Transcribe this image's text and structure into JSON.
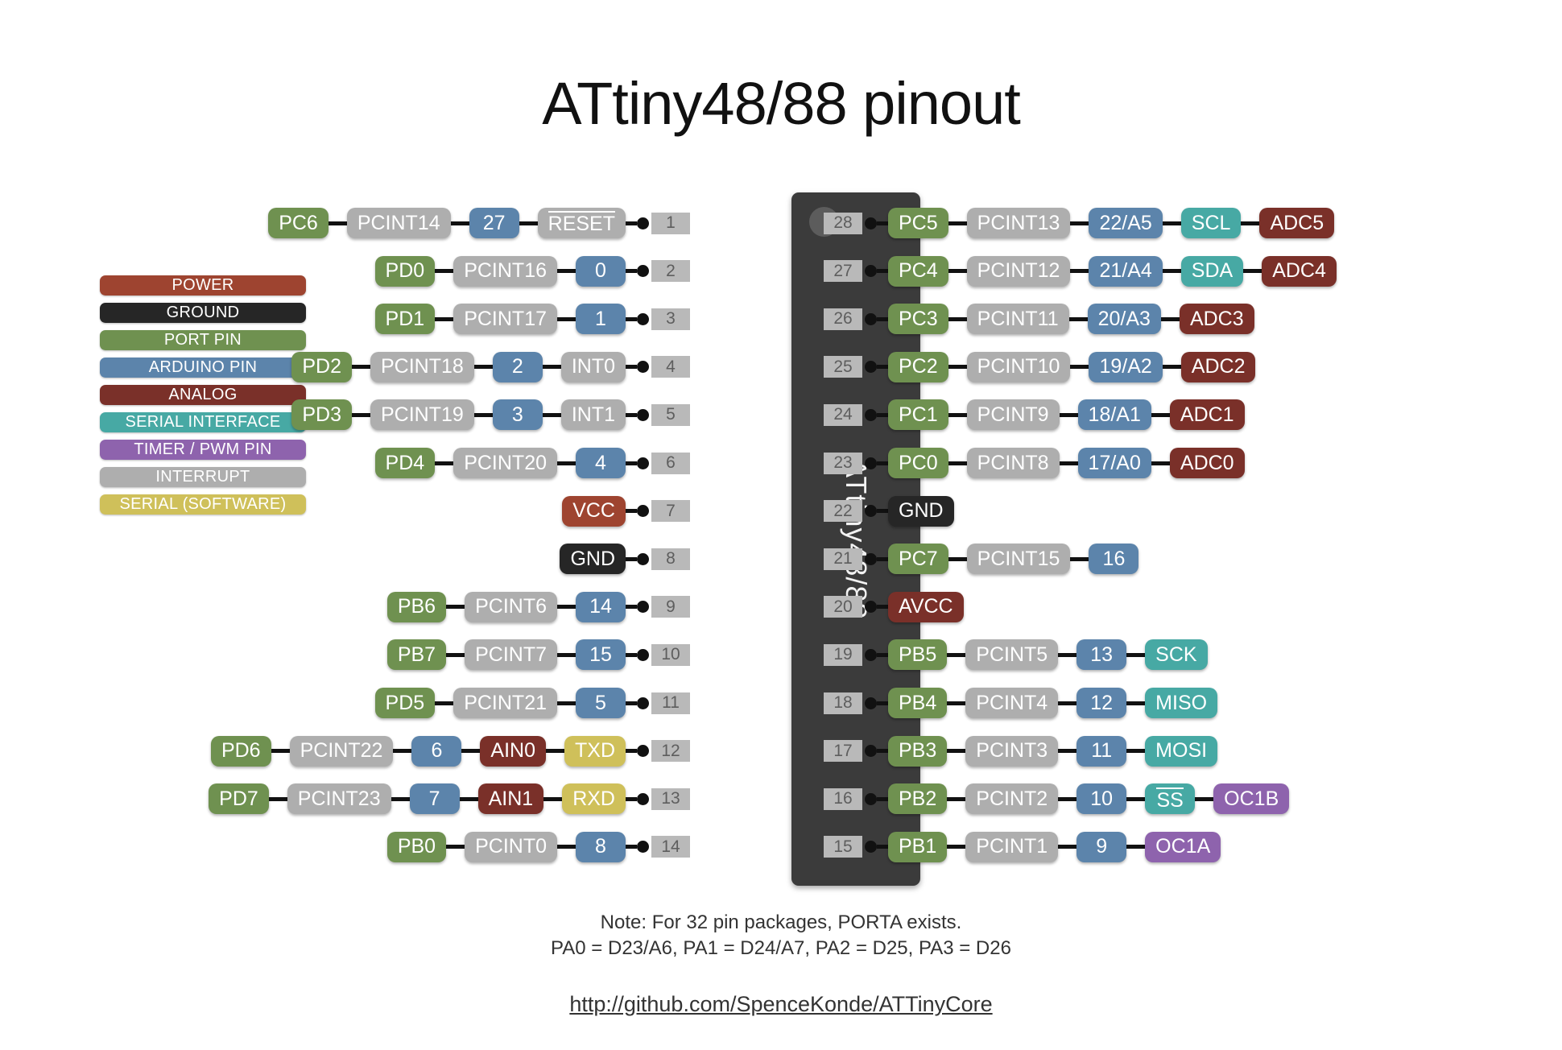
{
  "title": "ATtiny48/88 pinout",
  "chip": {
    "label": "ATtiny48/88"
  },
  "colors": {
    "power": "#9e4430",
    "ground": "#262626",
    "port": "#6f9150",
    "arduino": "#5c84ab",
    "analog": "#7a3029",
    "serial": "#47a9a4",
    "timer": "#8e63ad",
    "interrupt": "#aeaeae",
    "software": "#cfc05a",
    "pin_tab": "#b9b9b9",
    "wire": "#111111"
  },
  "legend": [
    {
      "label": "POWER",
      "type": "power"
    },
    {
      "label": "GROUND",
      "type": "ground"
    },
    {
      "label": "PORT PIN",
      "type": "port"
    },
    {
      "label": "ARDUINO PIN",
      "type": "arduino"
    },
    {
      "label": "ANALOG",
      "type": "analog"
    },
    {
      "label": "SERIAL INTERFACE",
      "type": "serial"
    },
    {
      "label": "TIMER / PWM PIN",
      "type": "timer"
    },
    {
      "label": "INTERRUPT",
      "type": "interrupt"
    },
    {
      "label": "SERIAL (SOFTWARE)",
      "type": "software"
    }
  ],
  "left_pins": [
    {
      "pin": "1",
      "badges": [
        {
          "label": "RESET",
          "type": "interrupt",
          "overline": true
        },
        {
          "label": "27",
          "type": "arduino"
        },
        {
          "label": "PCINT14",
          "type": "interrupt"
        },
        {
          "label": "PC6",
          "type": "port"
        }
      ]
    },
    {
      "pin": "2",
      "badges": [
        {
          "label": "0",
          "type": "arduino"
        },
        {
          "label": "PCINT16",
          "type": "interrupt"
        },
        {
          "label": "PD0",
          "type": "port"
        }
      ]
    },
    {
      "pin": "3",
      "badges": [
        {
          "label": "1",
          "type": "arduino"
        },
        {
          "label": "PCINT17",
          "type": "interrupt"
        },
        {
          "label": "PD1",
          "type": "port"
        }
      ]
    },
    {
      "pin": "4",
      "badges": [
        {
          "label": "INT0",
          "type": "interrupt"
        },
        {
          "label": "2",
          "type": "arduino"
        },
        {
          "label": "PCINT18",
          "type": "interrupt"
        },
        {
          "label": "PD2",
          "type": "port"
        }
      ]
    },
    {
      "pin": "5",
      "badges": [
        {
          "label": "INT1",
          "type": "interrupt"
        },
        {
          "label": "3",
          "type": "arduino"
        },
        {
          "label": "PCINT19",
          "type": "interrupt"
        },
        {
          "label": "PD3",
          "type": "port"
        }
      ]
    },
    {
      "pin": "6",
      "badges": [
        {
          "label": "4",
          "type": "arduino"
        },
        {
          "label": "PCINT20",
          "type": "interrupt"
        },
        {
          "label": "PD4",
          "type": "port"
        }
      ]
    },
    {
      "pin": "7",
      "badges": [
        {
          "label": "VCC",
          "type": "power"
        }
      ]
    },
    {
      "pin": "8",
      "badges": [
        {
          "label": "GND",
          "type": "ground"
        }
      ]
    },
    {
      "pin": "9",
      "badges": [
        {
          "label": "14",
          "type": "arduino"
        },
        {
          "label": "PCINT6",
          "type": "interrupt"
        },
        {
          "label": "PB6",
          "type": "port"
        }
      ]
    },
    {
      "pin": "10",
      "badges": [
        {
          "label": "15",
          "type": "arduino"
        },
        {
          "label": "PCINT7",
          "type": "interrupt"
        },
        {
          "label": "PB7",
          "type": "port"
        }
      ]
    },
    {
      "pin": "11",
      "badges": [
        {
          "label": "5",
          "type": "arduino"
        },
        {
          "label": "PCINT21",
          "type": "interrupt"
        },
        {
          "label": "PD5",
          "type": "port"
        }
      ]
    },
    {
      "pin": "12",
      "badges": [
        {
          "label": "TXD",
          "type": "software"
        },
        {
          "label": "AIN0",
          "type": "analog"
        },
        {
          "label": "6",
          "type": "arduino"
        },
        {
          "label": "PCINT22",
          "type": "interrupt"
        },
        {
          "label": "PD6",
          "type": "port"
        }
      ]
    },
    {
      "pin": "13",
      "badges": [
        {
          "label": "RXD",
          "type": "software"
        },
        {
          "label": "AIN1",
          "type": "analog"
        },
        {
          "label": "7",
          "type": "arduino"
        },
        {
          "label": "PCINT23",
          "type": "interrupt"
        },
        {
          "label": "PD7",
          "type": "port"
        }
      ]
    },
    {
      "pin": "14",
      "badges": [
        {
          "label": "8",
          "type": "arduino"
        },
        {
          "label": "PCINT0",
          "type": "interrupt"
        },
        {
          "label": "PB0",
          "type": "port"
        }
      ]
    }
  ],
  "right_pins": [
    {
      "pin": "28",
      "badges": [
        {
          "label": "PC5",
          "type": "port"
        },
        {
          "label": "PCINT13",
          "type": "interrupt"
        },
        {
          "label": "22/A5",
          "type": "arduino"
        },
        {
          "label": "SCL",
          "type": "serial"
        },
        {
          "label": "ADC5",
          "type": "analog"
        }
      ]
    },
    {
      "pin": "27",
      "badges": [
        {
          "label": "PC4",
          "type": "port"
        },
        {
          "label": "PCINT12",
          "type": "interrupt"
        },
        {
          "label": "21/A4",
          "type": "arduino"
        },
        {
          "label": "SDA",
          "type": "serial"
        },
        {
          "label": "ADC4",
          "type": "analog"
        }
      ]
    },
    {
      "pin": "26",
      "badges": [
        {
          "label": "PC3",
          "type": "port"
        },
        {
          "label": "PCINT11",
          "type": "interrupt"
        },
        {
          "label": "20/A3",
          "type": "arduino"
        },
        {
          "label": "ADC3",
          "type": "analog"
        }
      ]
    },
    {
      "pin": "25",
      "badges": [
        {
          "label": "PC2",
          "type": "port"
        },
        {
          "label": "PCINT10",
          "type": "interrupt"
        },
        {
          "label": "19/A2",
          "type": "arduino"
        },
        {
          "label": "ADC2",
          "type": "analog"
        }
      ]
    },
    {
      "pin": "24",
      "badges": [
        {
          "label": "PC1",
          "type": "port"
        },
        {
          "label": "PCINT9",
          "type": "interrupt"
        },
        {
          "label": "18/A1",
          "type": "arduino"
        },
        {
          "label": "ADC1",
          "type": "analog"
        }
      ]
    },
    {
      "pin": "23",
      "badges": [
        {
          "label": "PC0",
          "type": "port"
        },
        {
          "label": "PCINT8",
          "type": "interrupt"
        },
        {
          "label": "17/A0",
          "type": "arduino"
        },
        {
          "label": "ADC0",
          "type": "analog"
        }
      ]
    },
    {
      "pin": "22",
      "badges": [
        {
          "label": "GND",
          "type": "ground"
        }
      ]
    },
    {
      "pin": "21",
      "badges": [
        {
          "label": "PC7",
          "type": "port"
        },
        {
          "label": "PCINT15",
          "type": "interrupt"
        },
        {
          "label": "16",
          "type": "arduino"
        }
      ]
    },
    {
      "pin": "20",
      "badges": [
        {
          "label": "AVCC",
          "type": "analog"
        }
      ]
    },
    {
      "pin": "19",
      "badges": [
        {
          "label": "PB5",
          "type": "port"
        },
        {
          "label": "PCINT5",
          "type": "interrupt"
        },
        {
          "label": "13",
          "type": "arduino"
        },
        {
          "label": "SCK",
          "type": "serial"
        }
      ]
    },
    {
      "pin": "18",
      "badges": [
        {
          "label": "PB4",
          "type": "port"
        },
        {
          "label": "PCINT4",
          "type": "interrupt"
        },
        {
          "label": "12",
          "type": "arduino"
        },
        {
          "label": "MISO",
          "type": "serial"
        }
      ]
    },
    {
      "pin": "17",
      "badges": [
        {
          "label": "PB3",
          "type": "port"
        },
        {
          "label": "PCINT3",
          "type": "interrupt"
        },
        {
          "label": "11",
          "type": "arduino"
        },
        {
          "label": "MOSI",
          "type": "serial"
        }
      ]
    },
    {
      "pin": "16",
      "badges": [
        {
          "label": "PB2",
          "type": "port"
        },
        {
          "label": "PCINT2",
          "type": "interrupt"
        },
        {
          "label": "10",
          "type": "arduino"
        },
        {
          "label": "SS",
          "type": "serial",
          "overline": true
        },
        {
          "label": "OC1B",
          "type": "timer"
        }
      ]
    },
    {
      "pin": "15",
      "badges": [
        {
          "label": "PB1",
          "type": "port"
        },
        {
          "label": "PCINT1",
          "type": "interrupt"
        },
        {
          "label": "9",
          "type": "arduino"
        },
        {
          "label": "OC1A",
          "type": "timer"
        }
      ]
    }
  ],
  "footer": {
    "note_line1": "Note: For 32 pin packages, PORTA exists.",
    "note_line2": "PA0 = D23/A6, PA1 = D24/A7, PA2 = D25, PA3 = D26",
    "url": "http://github.com/SpenceKonde/ATTinyCore"
  }
}
